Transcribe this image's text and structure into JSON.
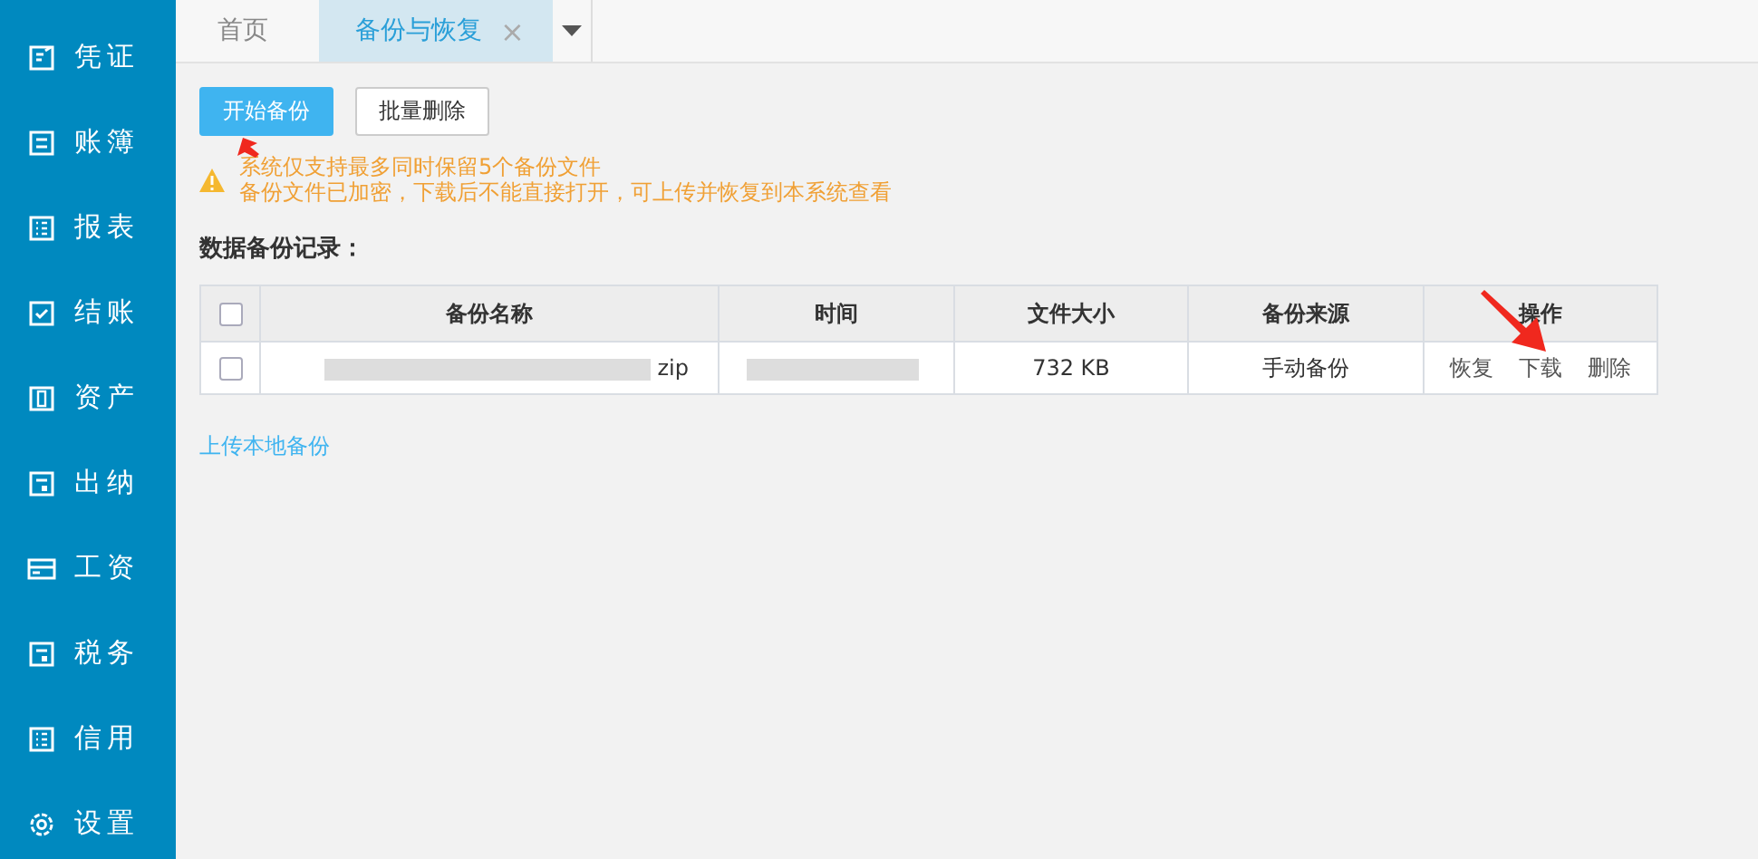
{
  "sidebar": {
    "items": [
      {
        "label": "凭证",
        "selected": false
      },
      {
        "label": "账簿",
        "selected": false
      },
      {
        "label": "报表",
        "selected": false
      },
      {
        "label": "结账",
        "selected": false
      },
      {
        "label": "资产",
        "selected": false
      },
      {
        "label": "出纳",
        "selected": false
      },
      {
        "label": "工资",
        "selected": false
      },
      {
        "label": "税务",
        "selected": false
      },
      {
        "label": "信用",
        "selected": false
      },
      {
        "label": "设置",
        "selected": false
      }
    ]
  },
  "tabs": [
    {
      "label": "首页",
      "selected": false
    },
    {
      "label": "备份与恢复",
      "selected": true,
      "close": "×"
    }
  ],
  "toolbar": {
    "buttons": [
      {
        "label": "开始备份",
        "kind": "primary"
      },
      {
        "label": "批量删除",
        "kind": "default"
      }
    ]
  },
  "notice": {
    "lines": [
      "系统仅支持最多同时保留5个备份文件",
      "备份文件已加密，下载后不能直接打开，可上传并恢复到本系统查看"
    ]
  },
  "section_title": "数据备份记录：",
  "table": {
    "select_all": {
      "checked": false
    },
    "columns": [
      "备份名称",
      "时间",
      "文件大小",
      "备份来源",
      "操作"
    ],
    "rows": [
      {
        "checked": false,
        "name": "zip",
        "size": "732 KB",
        "source": "手动备份",
        "actions": [
          "恢复",
          "下载",
          "删除"
        ]
      }
    ]
  },
  "upload_link": "上传本地备份"
}
